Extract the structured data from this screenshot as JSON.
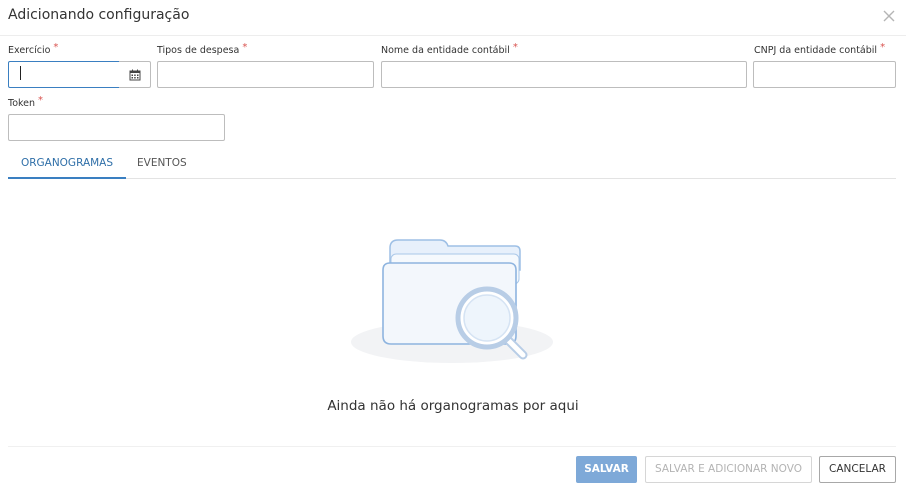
{
  "dialog": {
    "title": "Adicionando configuração"
  },
  "form": {
    "exercicio": {
      "label": "Exercício",
      "required_mark": "*",
      "value": ""
    },
    "tipos_despesa": {
      "label": "Tipos de despesa",
      "required_mark": "*",
      "value": ""
    },
    "nome_entidade": {
      "label": "Nome da entidade contábil",
      "required_mark": "*",
      "value": ""
    },
    "cnpj_entidade": {
      "label": "CNPJ da entidade contábil",
      "required_mark": "*",
      "value": ""
    },
    "token": {
      "label": "Token",
      "required_mark": "*",
      "value": ""
    }
  },
  "tabs": [
    {
      "label": "ORGANOGRAMAS",
      "active": true
    },
    {
      "label": "EVENTOS",
      "active": false
    }
  ],
  "empty_state": {
    "message": "Ainda não há organogramas por aqui",
    "icon": "folder-search-icon"
  },
  "footer": {
    "save_label": "SALVAR",
    "save_add_label": "SALVAR E ADICIONAR NOVO",
    "cancel_label": "CANCELAR"
  },
  "colors": {
    "primary": "#7ea9d8",
    "accent": "#3a7fc1",
    "required": "#d9534f"
  }
}
